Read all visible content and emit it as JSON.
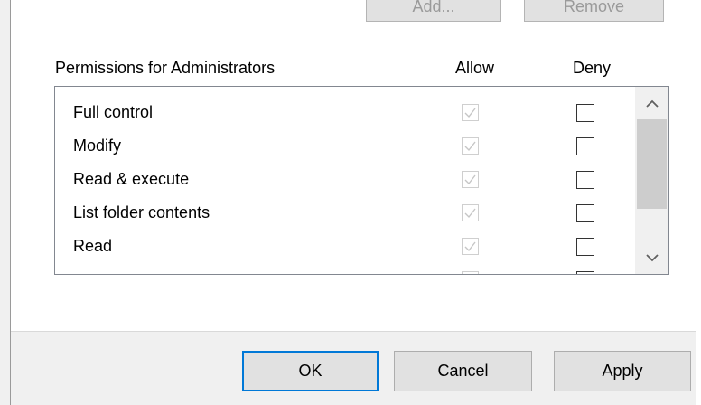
{
  "top_buttons": {
    "add_label": "Add...",
    "remove_label": "Remove"
  },
  "permissions": {
    "title": "Permissions for Administrators",
    "allow_header": "Allow",
    "deny_header": "Deny",
    "rows": [
      {
        "label": "Full control",
        "allow": true,
        "deny": false
      },
      {
        "label": "Modify",
        "allow": true,
        "deny": false
      },
      {
        "label": "Read & execute",
        "allow": true,
        "deny": false
      },
      {
        "label": "List folder contents",
        "allow": true,
        "deny": false
      },
      {
        "label": "Read",
        "allow": true,
        "deny": false
      },
      {
        "label": "",
        "allow": true,
        "deny": false
      }
    ]
  },
  "icons": {
    "scroll_up": "chevron-up-icon",
    "scroll_down": "chevron-down-icon",
    "checkmark": "checkmark-icon"
  },
  "footer": {
    "ok_label": "OK",
    "cancel_label": "Cancel",
    "apply_label": "Apply"
  },
  "colors": {
    "default_button_border": "#0078d7",
    "disabled_check": "#c6c6c6"
  }
}
